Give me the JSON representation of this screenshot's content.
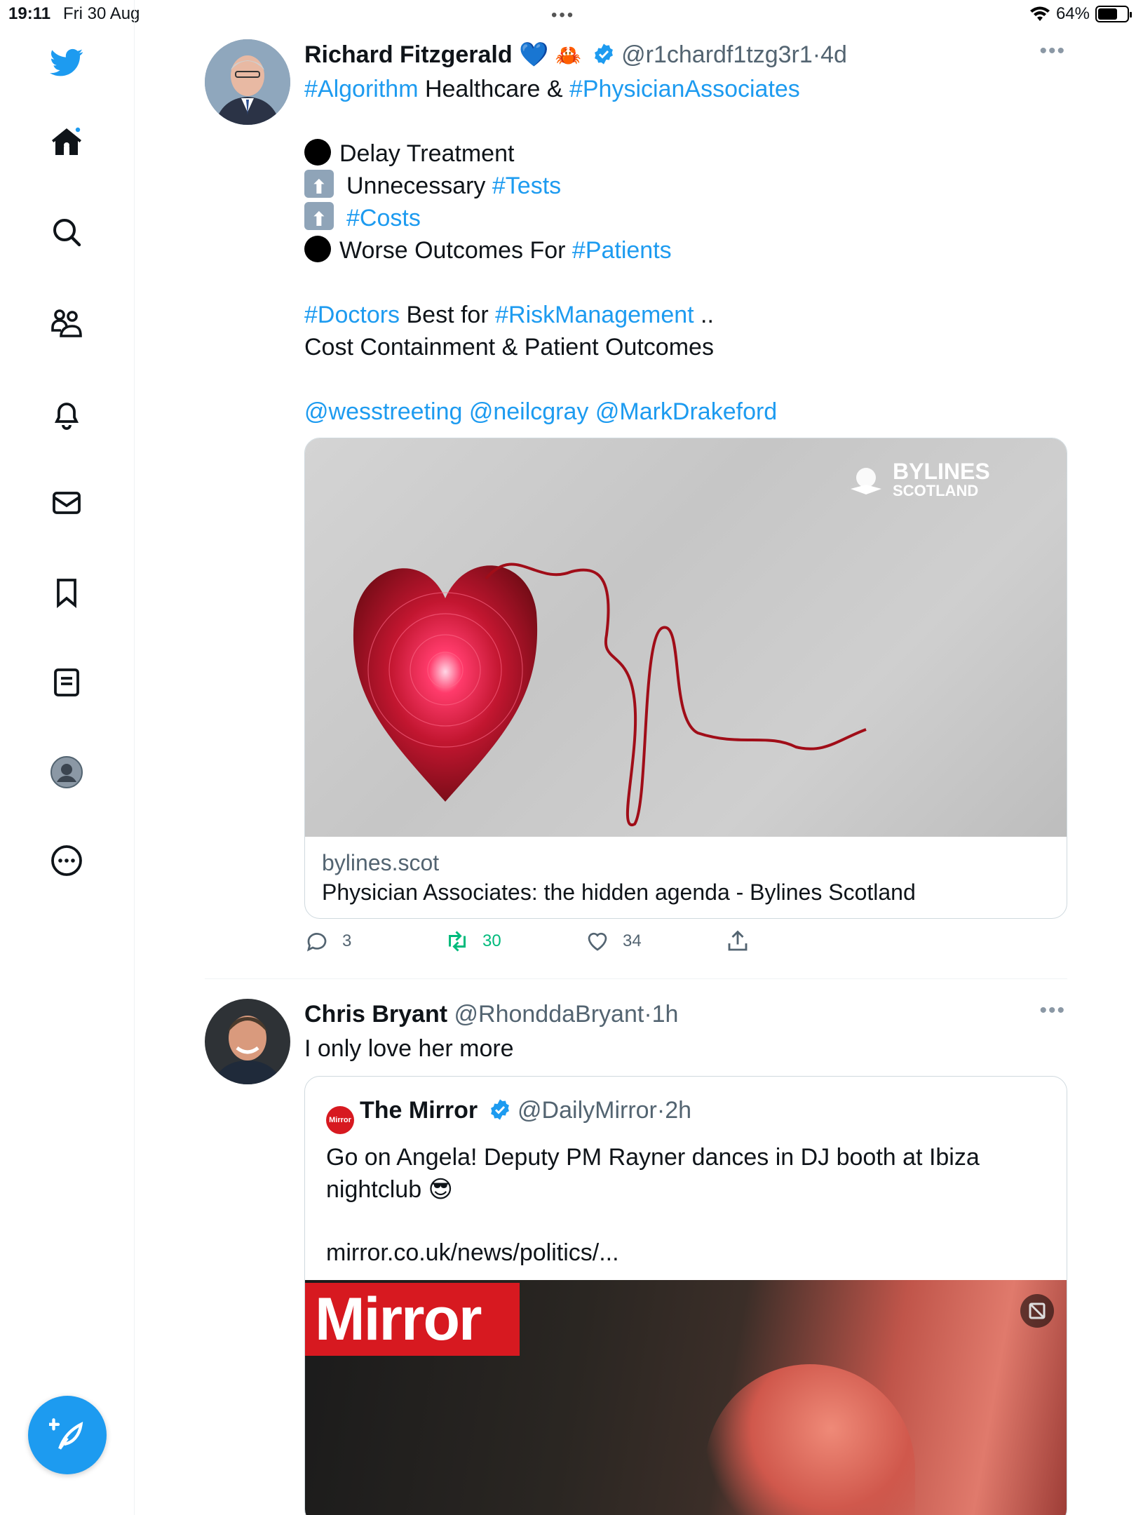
{
  "status_bar": {
    "time": "19:11",
    "date": "Fri 30 Aug",
    "battery": "64%",
    "battery_level": 0.64
  },
  "sidebar": {
    "items": [
      {
        "icon": "twitter-bird-icon"
      },
      {
        "icon": "home-icon"
      },
      {
        "icon": "search-icon"
      },
      {
        "icon": "communities-icon"
      },
      {
        "icon": "notifications-icon"
      },
      {
        "icon": "messages-icon"
      },
      {
        "icon": "bookmarks-icon"
      },
      {
        "icon": "lists-icon"
      },
      {
        "icon": "profile-icon"
      },
      {
        "icon": "more-icon"
      }
    ],
    "compose_icon": "compose-icon"
  },
  "tweets": [
    {
      "name": "Richard Fitzgerald",
      "name_emojis": "💙",
      "handle": "@r1chardf1tzg3r1",
      "sep": "·",
      "time": "4d",
      "bio_line": {
        "tag1": "#Algorithm",
        "text1": " Healthcare  & ",
        "tag2": "#PhysicianAssociates"
      },
      "lines": [
        {
          "text": "Delay Treatment"
        },
        {
          "text": "Unnecessary ",
          "tag": "#Tests"
        },
        {
          "text": "",
          "tag": "#Costs"
        },
        {
          "text": "Worse Outcomes For ",
          "tag": "#Patients"
        }
      ],
      "para2": {
        "tag1": "#Doctors",
        "text1": " Best for ",
        "tag2": "#RiskManagement",
        "text2": " ..",
        "line2": "Cost Containment & Patient Outcomes"
      },
      "mentions": "@wesstreeting @neilcgray @MarkDrakeford",
      "card": {
        "logo_line1": "BYLINES",
        "logo_line2": "SCOTLAND",
        "domain": "bylines.scot",
        "title": "Physician Associates: the hidden agenda - Bylines Scotland"
      },
      "actions": {
        "replies": "3",
        "retweets": "30",
        "likes": "34"
      }
    },
    {
      "name": "Chris Bryant",
      "handle": "@RhonddaBryant",
      "sep": "·",
      "time": "1h",
      "text": "I only love her more",
      "quote": {
        "logo_text": "Mirror",
        "name": "The Mirror",
        "handle": "@DailyMirror",
        "sep": "·",
        "time": "2h",
        "text": "Go on Angela! Deputy PM Rayner dances in DJ booth at Ibiza nightclub 😎",
        "link": "mirror.co.uk/news/politics/...",
        "image_logo": "Mirror"
      }
    }
  ],
  "colors": {
    "accent": "#1d9bf0",
    "retweet": "#00ba7c",
    "mirror_red": "#d71920"
  }
}
